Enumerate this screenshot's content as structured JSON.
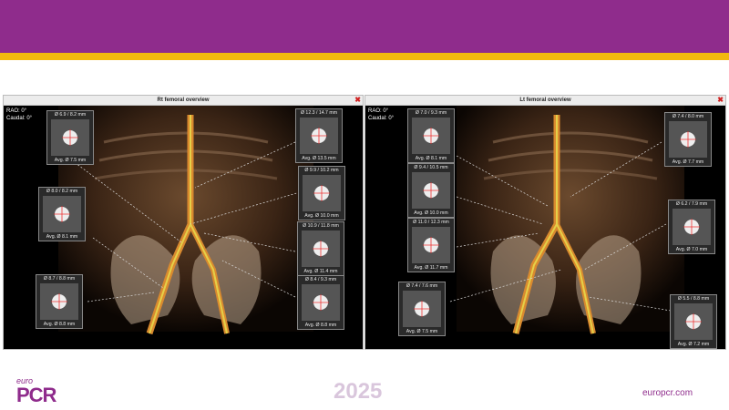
{
  "footer": {
    "brand_top": "euro",
    "brand_main": "PCR",
    "year": "2025",
    "site": "europcr.com"
  },
  "colors": {
    "brand": "#8f2c8c",
    "accent": "#f2b90f"
  },
  "panels": [
    {
      "title": "Rt femoral overview",
      "orientation": [
        "RAO: 0°",
        "Caudal: 0°"
      ],
      "insets": [
        {
          "dia": "Ø 6.9 / 8.2 mm",
          "avg": "Avg. Ø 7.5 mm"
        },
        {
          "dia": "Ø 8.0 / 8.2 mm",
          "avg": "Avg. Ø 8.1 mm"
        },
        {
          "dia": "Ø 8.7 / 8.8 mm",
          "avg": "Avg. Ø 8.8 mm"
        },
        {
          "dia": "Ø 12.3 / 14.7 mm",
          "avg": "Avg. Ø 13.5 mm"
        },
        {
          "dia": "Ø 9.9 / 10.2 mm",
          "avg": "Avg. Ø 10.0 mm"
        },
        {
          "dia": "Ø 10.9 / 11.8 mm",
          "avg": "Avg. Ø 11.4 mm"
        },
        {
          "dia": "Ø 8.4 / 9.3 mm",
          "avg": "Avg. Ø 8.8 mm"
        }
      ]
    },
    {
      "title": "Lt femoral overview",
      "orientation": [
        "RAO: 0°",
        "Caudal: 0°"
      ],
      "insets": [
        {
          "dia": "Ø 7.0 / 9.3 mm",
          "avg": "Avg. Ø 8.1 mm"
        },
        {
          "dia": "Ø 9.4 / 10.5 mm",
          "avg": "Avg. Ø 10.0 mm"
        },
        {
          "dia": "Ø 11.0 / 12.3 mm",
          "avg": "Avg. Ø 11.7 mm"
        },
        {
          "dia": "Ø 7.4 / 7.6 mm",
          "avg": "Avg. Ø 7.5 mm"
        },
        {
          "dia": "Ø 7.4 / 8.0 mm",
          "avg": "Avg. Ø 7.7 mm"
        },
        {
          "dia": "Ø 6.2 / 7.9 mm",
          "avg": "Avg. Ø 7.0 mm"
        },
        {
          "dia": "Ø 5.5 / 8.8 mm",
          "avg": "Avg. Ø 7.2 mm"
        }
      ]
    }
  ]
}
